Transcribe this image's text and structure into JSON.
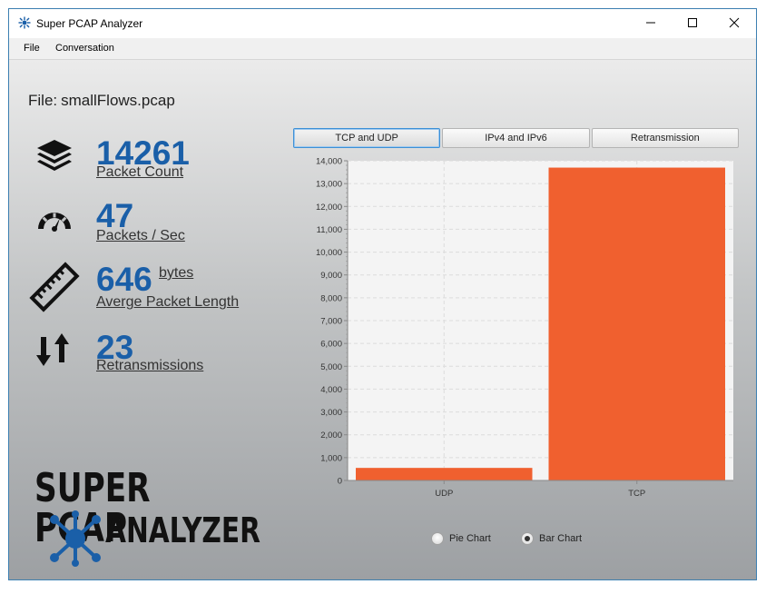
{
  "window": {
    "title": "Super PCAP Analyzer",
    "controls": [
      "minimize-icon",
      "maximize-icon",
      "close-icon"
    ]
  },
  "menu": {
    "file": "File",
    "conversation": "Conversation"
  },
  "file": {
    "label": "File:",
    "name": "smallFlows.pcap"
  },
  "stats": {
    "packet_count": {
      "value": "14261",
      "label": "Packet Count",
      "icon": "layers-icon"
    },
    "packets_per_sec": {
      "value": "47",
      "label": "Packets / Sec",
      "icon": "speedometer-icon"
    },
    "avg_length": {
      "value": "646",
      "unit": "bytes",
      "label": "Averge Packet Length",
      "icon": "ruler-icon"
    },
    "retransmissions": {
      "value": "23",
      "label": "Retransmissions",
      "icon": "up-down-arrows-icon"
    }
  },
  "logo": {
    "line1": "SUPER PCAP",
    "line2": "ANALYZER"
  },
  "tabs": [
    "TCP and UDP",
    "IPv4 and IPv6",
    "Retransmission"
  ],
  "active_tab": "TCP and UDP",
  "radio": {
    "pie": "Pie Chart",
    "bar": "Bar Chart",
    "selected": "Bar Chart"
  },
  "colors": {
    "accent": "#1a5fa8",
    "bar": "#f0602f"
  },
  "chart_data": {
    "type": "bar",
    "categories": [
      "UDP",
      "TCP"
    ],
    "values": [
      550,
      13700
    ],
    "ylim": [
      0,
      14000
    ],
    "yticks": [
      "0",
      "1,000",
      "2,000",
      "3,000",
      "4,000",
      "5,000",
      "6,000",
      "7,000",
      "8,000",
      "9,000",
      "10,000",
      "11,000",
      "12,000",
      "13,000",
      "14,000"
    ],
    "grid": true
  }
}
